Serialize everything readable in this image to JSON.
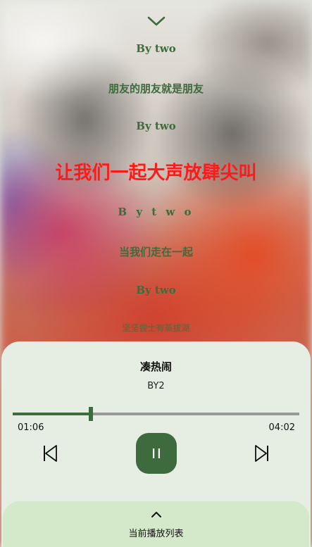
{
  "lyrics": {
    "lines": [
      "By two",
      "朋友的朋友就是朋友",
      "By two",
      "让我们一起大声放肆尖叫",
      "B y t w o",
      "当我们走在一起",
      "By two",
      "坚坚尝士有蒸拔湖"
    ],
    "active_index": 3,
    "active_color": "#ff1a1a",
    "line_color": "#3e6b3d"
  },
  "player": {
    "song_title": "凑热闹",
    "artist": "BY2",
    "elapsed": "01:06",
    "duration": "04:02",
    "progress_fraction": 0.273,
    "accent_color": "#3e6b3d"
  },
  "icons": {
    "collapse": "chevron-down-icon",
    "previous": "skip-previous-icon",
    "play_pause": "pause-icon",
    "next": "skip-next-icon",
    "playlist": "chevron-up-icon"
  },
  "playlist": {
    "label": "当前播放列表"
  }
}
